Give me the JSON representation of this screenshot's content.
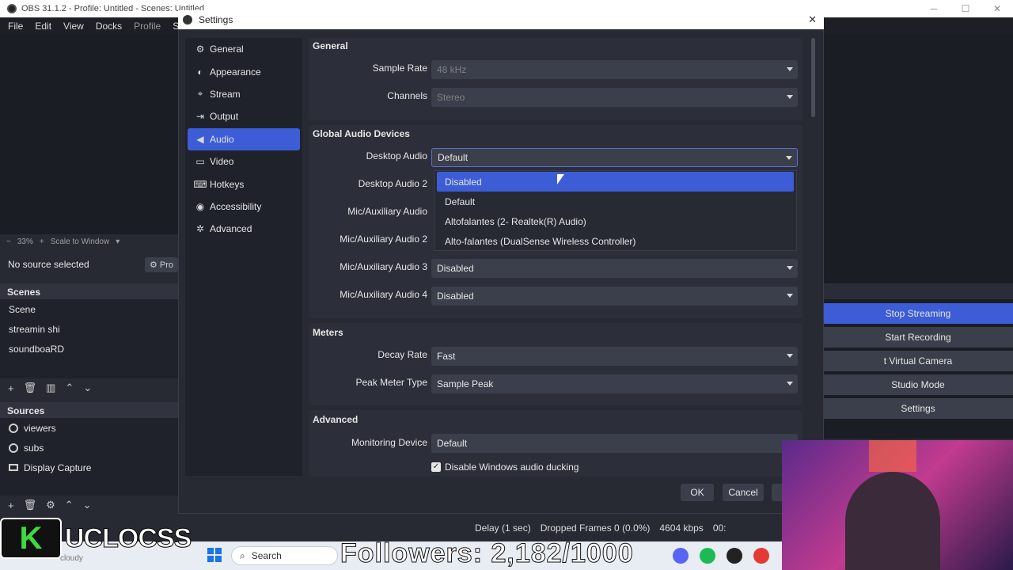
{
  "obs": {
    "window_title": "OBS 31.1.2 - Profile: Untitled - Scenes: Untitled",
    "menu": [
      "File",
      "Edit",
      "View",
      "Docks",
      "Profile",
      "Scene"
    ],
    "preview_zoom": "33%",
    "scale_mode": "Scale to Window",
    "no_source": "No source selected",
    "properties_label": "Pro",
    "scenes_header": "Scenes",
    "scenes": [
      "Scene",
      "streamin shi",
      "soundboaRD"
    ],
    "sources_header": "Sources",
    "sources": [
      "viewers",
      "subs",
      "Display Capture"
    ],
    "controls": {
      "stop_streaming": "Stop Streaming",
      "start_recording": "Start Recording",
      "virtual_camera": "t Virtual Camera",
      "studio_mode": "Studio Mode",
      "settings": "Settings"
    },
    "status": {
      "delay": "Delay (1 sec)",
      "dropped": "Dropped Frames 0 (0.0%)",
      "bitrate": "4604 kbps",
      "time": "00:"
    }
  },
  "overlay": {
    "followers": "Followers: 2,182/1000",
    "logo_letter": "K",
    "logo_name": "UCLOCSS",
    "weather": "cloudy",
    "taskbar_search": "Search"
  },
  "settings": {
    "title": "Settings",
    "nav": [
      {
        "label": "General",
        "icon": "gear-icon"
      },
      {
        "label": "Appearance",
        "icon": "palette-icon"
      },
      {
        "label": "Stream",
        "icon": "antenna-icon"
      },
      {
        "label": "Output",
        "icon": "output-icon"
      },
      {
        "label": "Audio",
        "icon": "speaker-icon",
        "selected": true
      },
      {
        "label": "Video",
        "icon": "monitor-icon"
      },
      {
        "label": "Hotkeys",
        "icon": "keyboard-icon"
      },
      {
        "label": "Accessibility",
        "icon": "accessibility-icon"
      },
      {
        "label": "Advanced",
        "icon": "wrench-icon"
      }
    ],
    "general": {
      "header": "General",
      "sample_rate_label": "Sample Rate",
      "sample_rate": "48 kHz",
      "channels_label": "Channels",
      "channels": "Stereo"
    },
    "global_audio": {
      "header": "Global Audio Devices",
      "desktop_audio_label": "Desktop Audio",
      "desktop_audio": "Default",
      "desktop_audio2_label": "Desktop Audio 2",
      "mic1_label": "Mic/Auxiliary Audio",
      "mic2_label": "Mic/Auxiliary Audio 2",
      "mic3_label": "Mic/Auxiliary Audio 3",
      "mic3": "Disabled",
      "mic4_label": "Mic/Auxiliary Audio 4",
      "mic4": "Disabled"
    },
    "dropdown_options": [
      "Disabled",
      "Default",
      "Altofalantes (2- Realtek(R) Audio)",
      "Alto-falantes (DualSense Wireless Controller)"
    ],
    "meters": {
      "header": "Meters",
      "decay_label": "Decay Rate",
      "decay": "Fast",
      "peak_label": "Peak Meter Type",
      "peak": "Sample Peak"
    },
    "advanced": {
      "header": "Advanced",
      "monitoring_label": "Monitoring Device",
      "monitoring": "Default",
      "ducking": "Disable Windows audio ducking"
    },
    "ok": "OK",
    "cancel": "Cancel"
  },
  "colors": {
    "accent": "#3c5dd6",
    "bg": "#272a33"
  }
}
